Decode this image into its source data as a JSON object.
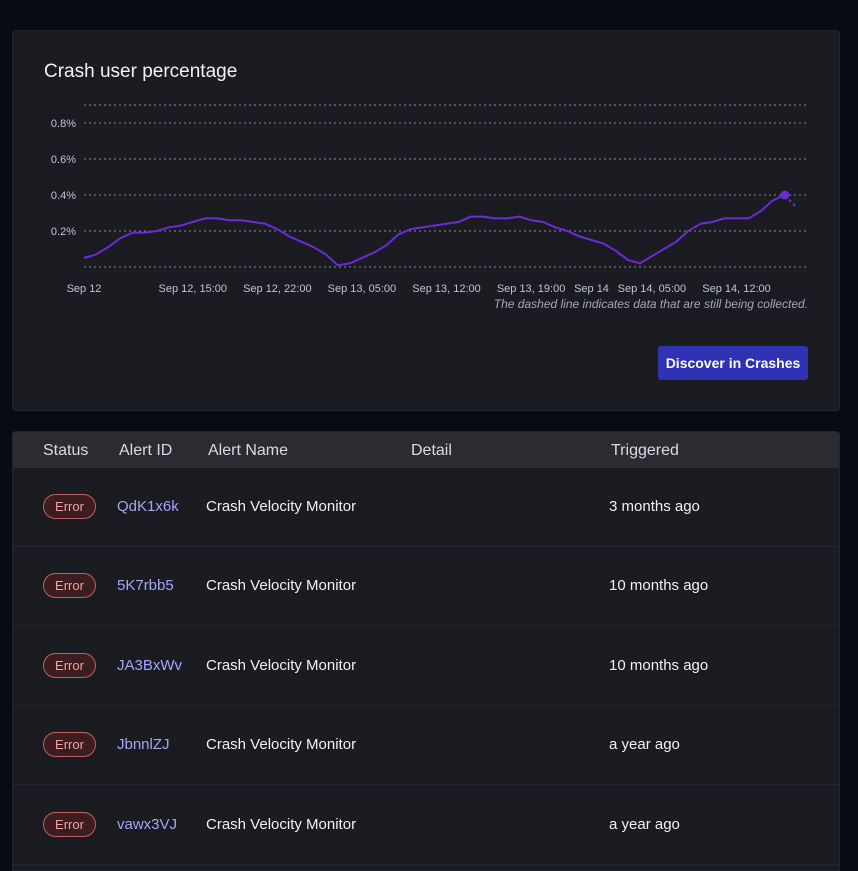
{
  "chart_card": {
    "title": "Crash user percentage",
    "note": "The dashed line indicates data that are still being collected.",
    "discover_button": "Discover in Crashes"
  },
  "chart_data": {
    "type": "line",
    "title": "Crash user percentage",
    "xlabel": "",
    "ylabel": "",
    "ylim": [
      0,
      0.9
    ],
    "y_ticks": [
      "0.2%",
      "0.4%",
      "0.6%",
      "0.8%"
    ],
    "y_tick_values": [
      0.2,
      0.4,
      0.6,
      0.8
    ],
    "x_ticks": [
      "Sep 12",
      "Sep 12, 15:00",
      "Sep 12, 22:00",
      "Sep 13, 05:00",
      "Sep 13, 12:00",
      "Sep 13, 19:00",
      "Sep 14",
      "Sep 14, 05:00",
      "Sep 14, 12:00"
    ],
    "x_tick_hours": [
      0,
      9,
      16,
      23,
      30,
      37,
      42,
      47,
      54
    ],
    "x_range_hours": [
      0,
      60
    ],
    "grid": "horizontal dotted",
    "line_color": "#6b2bd9",
    "series": [
      {
        "hours": [
          0,
          1,
          2,
          3,
          4,
          5,
          6,
          7,
          8,
          9,
          10,
          11,
          12,
          13,
          14,
          15,
          16,
          17,
          18,
          19,
          20,
          21,
          22,
          23,
          24,
          25,
          26,
          27,
          28,
          29,
          30,
          31,
          32,
          33,
          34,
          35,
          36,
          37,
          38,
          39,
          40,
          41,
          42,
          43,
          44,
          45,
          46,
          47,
          48,
          49,
          50,
          51,
          52,
          53,
          54,
          55,
          56,
          57,
          58
        ],
        "values": [
          0.05,
          0.07,
          0.11,
          0.16,
          0.19,
          0.19,
          0.2,
          0.22,
          0.23,
          0.25,
          0.27,
          0.27,
          0.26,
          0.26,
          0.25,
          0.24,
          0.21,
          0.17,
          0.14,
          0.11,
          0.07,
          0.01,
          0.02,
          0.05,
          0.08,
          0.12,
          0.18,
          0.21,
          0.22,
          0.23,
          0.24,
          0.25,
          0.28,
          0.28,
          0.27,
          0.27,
          0.28,
          0.26,
          0.25,
          0.22,
          0.2,
          0.17,
          0.15,
          0.13,
          0.09,
          0.04,
          0.02,
          0.06,
          0.1,
          0.14,
          0.2,
          0.24,
          0.25,
          0.27,
          0.27,
          0.27,
          0.31,
          0.37,
          0.4
        ]
      },
      {
        "dashed": true,
        "hours": [
          58,
          59
        ],
        "values": [
          0.4,
          0.33
        ]
      }
    ]
  },
  "table": {
    "headers": {
      "status": "Status",
      "alert_id": "Alert ID",
      "alert_name": "Alert Name",
      "detail": "Detail",
      "triggered": "Triggered"
    },
    "rows": [
      {
        "status": "Error",
        "alert_id": "QdK1x6k",
        "alert_name": "Crash Velocity Monitor",
        "detail": "",
        "triggered": "3 months ago"
      },
      {
        "status": "Error",
        "alert_id": "5K7rbb5",
        "alert_name": "Crash Velocity Monitor",
        "detail": "",
        "triggered": "10 months ago"
      },
      {
        "status": "Error",
        "alert_id": "JA3BxWv",
        "alert_name": "Crash Velocity Monitor",
        "detail": "",
        "triggered": "10 months ago"
      },
      {
        "status": "Error",
        "alert_id": "JbnnlZJ",
        "alert_name": "Crash Velocity Monitor",
        "detail": "",
        "triggered": "a year ago"
      },
      {
        "status": "Error",
        "alert_id": "vawx3VJ",
        "alert_name": "Crash Velocity Monitor",
        "detail": "",
        "triggered": "a year ago"
      }
    ]
  }
}
